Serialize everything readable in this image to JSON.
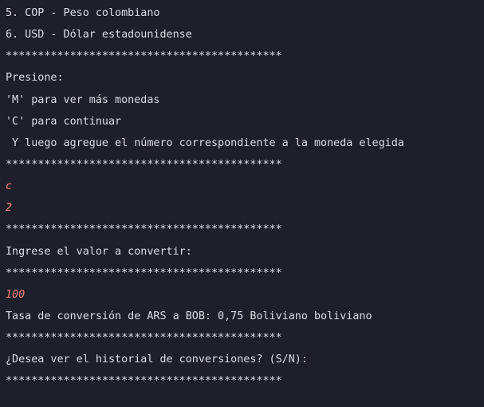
{
  "console": {
    "lines": [
      {
        "text": "5. COP - Peso colombiano",
        "kind": "output"
      },
      {
        "text": "6. USD - Dólar estadounidense",
        "kind": "output"
      },
      {
        "text": "*******************************************",
        "kind": "separator"
      },
      {
        "text": "Presione:",
        "kind": "output"
      },
      {
        "text": "'M' para ver más monedas",
        "kind": "output"
      },
      {
        "text": "'C' para continuar",
        "kind": "output"
      },
      {
        "text": " Y luego agregue el número correspondiente a la moneda elegida",
        "kind": "output"
      },
      {
        "text": "*******************************************",
        "kind": "separator"
      },
      {
        "text": "c",
        "kind": "user"
      },
      {
        "text": "2",
        "kind": "user"
      },
      {
        "text": "*******************************************",
        "kind": "separator"
      },
      {
        "text": "Ingrese el valor a convertir:",
        "kind": "output"
      },
      {
        "text": "*******************************************",
        "kind": "separator"
      },
      {
        "text": "100",
        "kind": "user"
      },
      {
        "text": "Tasa de conversión de ARS a BOB: 0,75 Boliviano boliviano",
        "kind": "output"
      },
      {
        "text": "*******************************************",
        "kind": "separator"
      },
      {
        "text": "¿Desea ver el historial de conversiones? (S/N):",
        "kind": "output"
      },
      {
        "text": "*******************************************",
        "kind": "separator"
      }
    ]
  },
  "colors": {
    "background": "#1e1f2b",
    "output_text": "#dcdde6",
    "user_input_text": "#f0837a"
  }
}
